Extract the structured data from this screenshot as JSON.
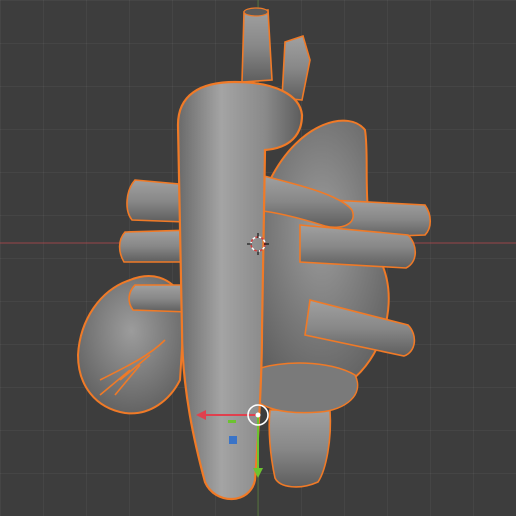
{
  "viewport": {
    "background": "#3d3d3d",
    "x_axis_color": "#b0474c",
    "y_axis_color": "#5f8f35",
    "selection_outline_color": "#f07a27",
    "active_outline_color": "#ff9a40",
    "mesh_color": "#8e8e8e"
  },
  "object": {
    "name_icon": "heart-mesh",
    "selected": true
  },
  "gizmo": {
    "type": "move-gizmo",
    "x_color": "#e0404e",
    "y_color": "#6cc330",
    "z_color": "#3a74c8",
    "pivot_color": "#ffffff"
  },
  "cursor": {
    "icon": "3d-cursor-icon",
    "ring_color_a": "#d04040",
    "ring_color_b": "#ffffff"
  }
}
